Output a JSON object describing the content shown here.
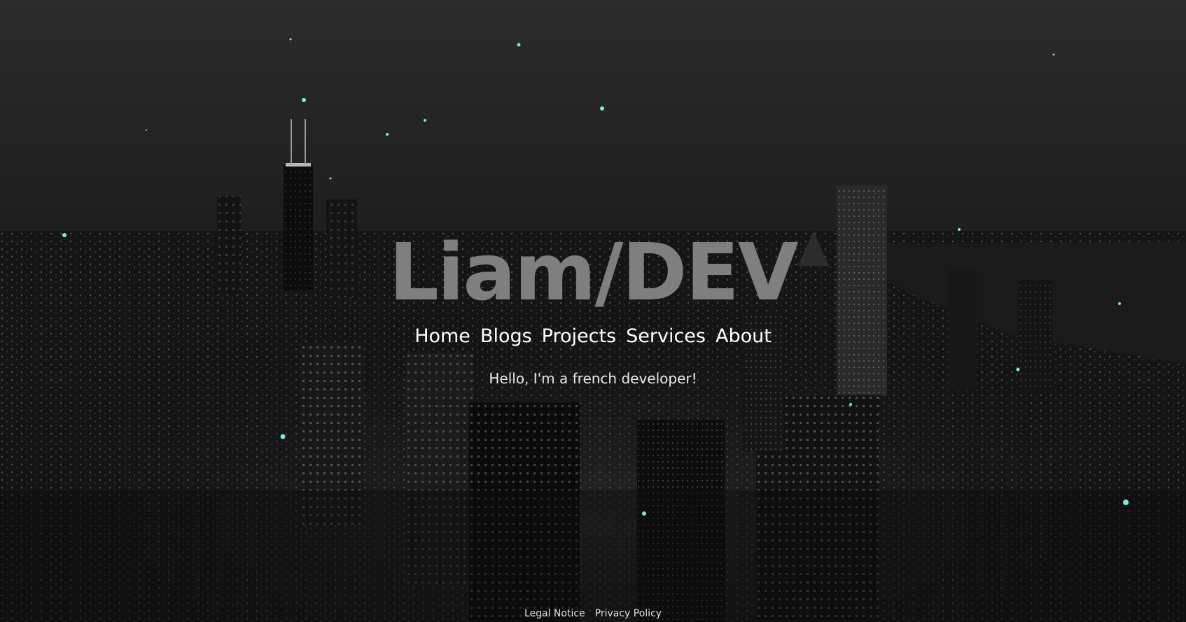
{
  "hero": {
    "title": "Liam/DEV",
    "tagline": "Hello, I'm a french developer!"
  },
  "nav": {
    "items": [
      {
        "label": "Home"
      },
      {
        "label": "Blogs"
      },
      {
        "label": "Projects"
      },
      {
        "label": "Services"
      },
      {
        "label": "About"
      }
    ]
  },
  "footer": {
    "links": [
      {
        "label": "Legal Notice"
      },
      {
        "label": "Privacy Policy"
      }
    ]
  },
  "theme": {
    "title_color": "#7f7f7f",
    "text_color": "#ffffff",
    "particle_color": "#7fe8e0",
    "background": "#1c1c1c"
  }
}
